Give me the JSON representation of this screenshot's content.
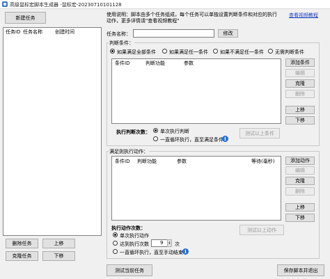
{
  "window": {
    "title": "高级鼠标宏脚本生成器 -鼠标宏-20230710101128"
  },
  "left": {
    "new_task_button": "新建任务",
    "columns": [
      "任务ID",
      "任务名称",
      "创建时间"
    ],
    "delete_button": "删除任务",
    "up_button": "上移",
    "clone_button": "克隆任务",
    "down_button": "下移"
  },
  "header": {
    "description": "使用说明：脚本由多个任务组成，每个任务可以单独设置判断条件和对应的执行动作，更多详情请\"查看视频教程\"",
    "video_link": "查看视频教程"
  },
  "task_name": {
    "label": "任务名称：",
    "value": "",
    "modify_button": "修改"
  },
  "conditions": {
    "group_title": "判断条件：",
    "radios": [
      {
        "label": "如果满足全部条件",
        "checked": true
      },
      {
        "label": "如果满足任一条件",
        "checked": false
      },
      {
        "label": "如果不满足任一条件",
        "checked": false
      },
      {
        "label": "无需判断条件",
        "checked": false
      }
    ],
    "columns": [
      "条件ID",
      "判断功能",
      "参数"
    ],
    "buttons": {
      "add": "添加条件",
      "edit": "编辑",
      "clone": "克隆",
      "delete": "删除",
      "up": "上移",
      "down": "下移"
    },
    "exec_count_label": "执行判断次数：",
    "exec_options": [
      {
        "label": "单次执行判断",
        "checked": true
      },
      {
        "label": "一直循环执行，直至满足条件",
        "checked": false
      }
    ],
    "test_button": "测试以上条件"
  },
  "actions": {
    "group_title": "满足则执行动作：",
    "columns": [
      "条件ID",
      "判断功能",
      "参数",
      "等待(毫秒)"
    ],
    "buttons": {
      "add": "添加动作",
      "edit": "编辑",
      "clone": "克隆",
      "delete": "删除",
      "up": "上移",
      "down": "下移"
    },
    "exec_count_label": "执行动作次数：",
    "exec_options": [
      {
        "label": "单次执行动作",
        "checked": true
      },
      {
        "label": "达到执行次数",
        "checked": false
      },
      {
        "label": "一直循环执行，直至手动结束",
        "checked": false
      }
    ],
    "count_value": "9",
    "count_unit": "次",
    "test_button": "测试以上动作"
  },
  "footer": {
    "test_task_button": "测试当前任务",
    "save_exit_button": "保存脚本并退出"
  },
  "colors": {
    "window_bg": "#f0f0f0",
    "link": "#1a3fbf",
    "info": "#1d6fd8"
  }
}
